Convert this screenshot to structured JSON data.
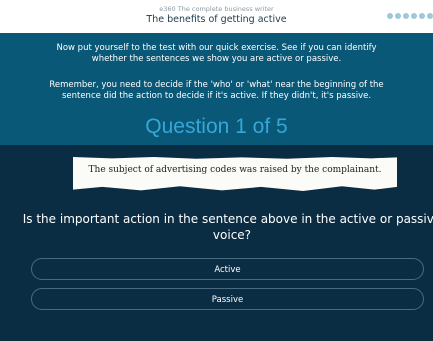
{
  "header": {
    "course_name": "e360 The complete business writer",
    "page_title": "The benefits of getting active",
    "progress_dots": 6
  },
  "instructions": {
    "line1": "Now put yourself to the test with our quick exercise. See if you can identify whether the sentences we show you are active or passive.",
    "line2": "Remember, you need to decide if the 'who' or 'what' near the beginning of the sentence did the action to decide if it's active. If they didn't, it's passive."
  },
  "question_counter": "Question 1 of 5",
  "sentence": "The subject of advertising codes was raised by the complainant.",
  "question": "Is the important action in the sentence above in the active or passive voice?",
  "answers": [
    "Active",
    "Passive"
  ],
  "colors": {
    "header_bg": "#ffffff",
    "top_panel": "#0a5877",
    "bottom_panel": "#0b2d44",
    "accent": "#35a7d7",
    "progress_dot": "#9ec8da"
  }
}
